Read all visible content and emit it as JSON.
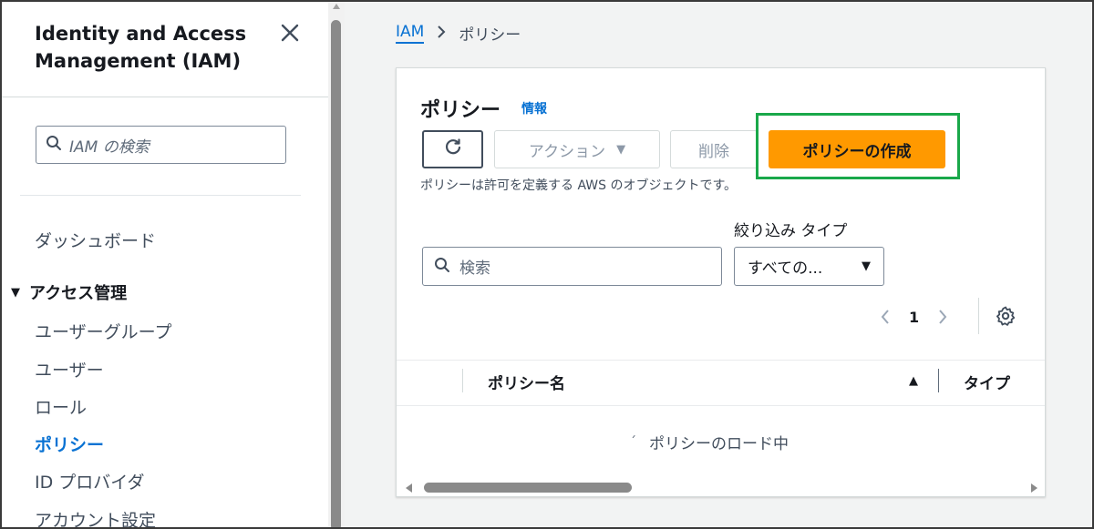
{
  "sidebar": {
    "title": "Identity and Access Management (IAM)",
    "search_placeholder": "IAM の検索",
    "dashboard_label": "ダッシュボード",
    "section_label": "アクセス管理",
    "items": [
      {
        "label": "ユーザーグループ"
      },
      {
        "label": "ユーザー"
      },
      {
        "label": "ロール"
      },
      {
        "label": "ポリシー"
      },
      {
        "label": "ID プロバイダ"
      },
      {
        "label": "アカウント設定"
      }
    ],
    "active_item": "ポリシー"
  },
  "breadcrumb": {
    "root": "IAM",
    "current": "ポリシー"
  },
  "panel": {
    "title": "ポリシー",
    "info_link": "情報",
    "actions_label": "アクション",
    "delete_label": "削除",
    "create_label": "ポリシーの作成",
    "description": "ポリシーは許可を定義する AWS のオブジェクトです。"
  },
  "filter": {
    "search_placeholder": "検索",
    "type_label": "絞り込み タイプ",
    "type_value": "すべての..."
  },
  "pagination": {
    "current_page": "1"
  },
  "table": {
    "col_name": "ポリシー名",
    "col_type": "タイプ",
    "loading_text": "ポリシーのロード中"
  },
  "colors": {
    "primary_button": "#ff9900",
    "link": "#0972d3",
    "highlight_box": "#1aa84a"
  },
  "icons": {
    "close": "close-icon",
    "search": "search-icon",
    "refresh": "refresh-icon",
    "settings": "gear-icon"
  }
}
